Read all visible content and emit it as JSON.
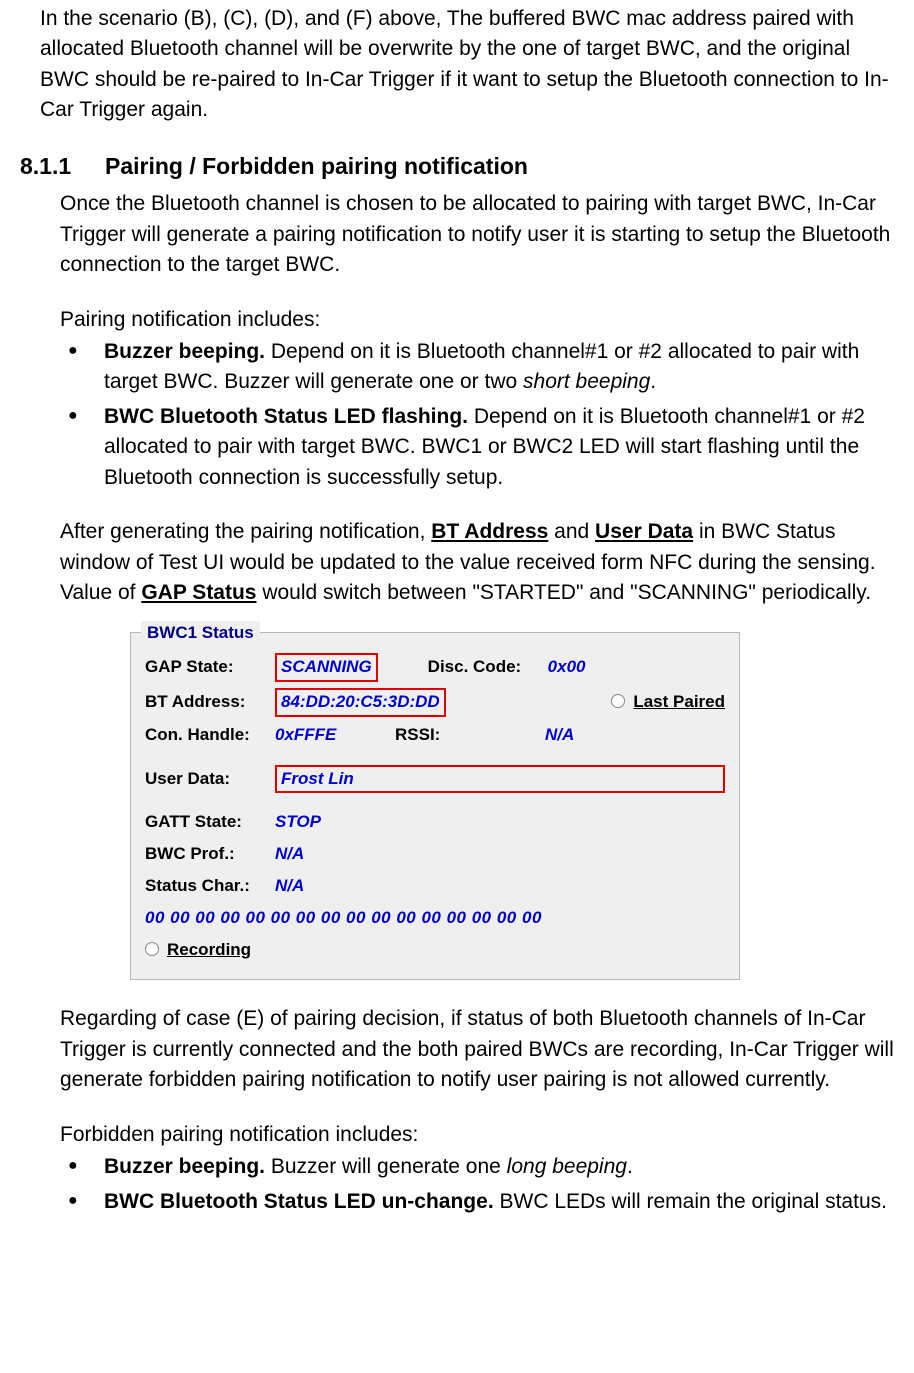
{
  "intro": "In the scenario (B), (C), (D), and (F) above, The buffered BWC mac address paired with allocated Bluetooth channel will be overwrite by the one of target BWC, and the original BWC should be re-paired to In-Car Trigger if it want to setup the Bluetooth connection to In-Car Trigger again.",
  "section_num": "8.1.1",
  "section_title": "Pairing / Forbidden pairing notification",
  "p1": "Once the Bluetooth channel is chosen to be allocated to pairing with target BWC, In-Car Trigger will generate a pairing notification to notify user it is starting to setup the Bluetooth connection to the target BWC.",
  "pair_notif_label": "Pairing notification includes:",
  "pair_list": {
    "b1_bold": "Buzzer beeping.",
    "b1_rest_a": " Depend on it is Bluetooth channel#1 or #2 allocated to pair with target BWC. Buzzer will generate one or two ",
    "b1_italic": "short beeping",
    "b1_rest_b": ".",
    "b2_bold": "BWC Bluetooth Status LED flashing.",
    "b2_rest": " Depend on it is Bluetooth channel#1 or #2 allocated to pair with target BWC. BWC1 or BWC2 LED will start flashing until the Bluetooth connection is successfully setup."
  },
  "p2_a": "After generating the pairing notification, ",
  "p2_u1": "BT Address",
  "p2_b": " and ",
  "p2_u2": "User Data",
  "p2_c": " in BWC Status window of Test UI would be updated to the value received form NFC during the sensing. Value of ",
  "p2_u3": "GAP Status",
  "p2_d": " would switch between \"STARTED\" and \"SCANNING\" periodically.",
  "panel": {
    "title": "BWC1 Status",
    "gap_state_lbl": "GAP State:",
    "gap_state_val": "SCANNING",
    "disc_code_lbl": "Disc. Code:",
    "disc_code_val": "0x00",
    "bt_addr_lbl": "BT Address:",
    "bt_addr_val": "84:DD:20:C5:3D:DD",
    "last_paired_lbl": "Last Paired",
    "con_handle_lbl": "Con. Handle:",
    "con_handle_val": "0xFFFE",
    "rssi_lbl": "RSSI:",
    "rssi_val": "N/A",
    "user_data_lbl": "User Data:",
    "user_data_val": "Frost Lin",
    "gatt_state_lbl": "GATT State:",
    "gatt_state_val": "STOP",
    "bwc_prof_lbl": "BWC Prof.:",
    "bwc_prof_val": "N/A",
    "status_char_lbl": "Status Char.:",
    "status_char_val": "N/A",
    "hex_line": "00 00 00 00 00 00 00 00 00 00 00 00 00 00 00 00",
    "recording_lbl": "Recording"
  },
  "p3": "Regarding of case (E) of pairing decision, if status of both Bluetooth channels of In-Car Trigger is currently connected and the both paired BWCs are recording, In-Car Trigger will generate forbidden pairing notification to notify user pairing is not allowed currently.",
  "forbid_notif_label": "Forbidden pairing notification includes:",
  "forbid_list": {
    "b1_bold": "Buzzer beeping.",
    "b1_rest_a": " Buzzer will generate one ",
    "b1_italic": "long beeping",
    "b1_rest_b": ".",
    "b2_bold": "BWC Bluetooth Status LED un-change.",
    "b2_rest": " BWC LEDs will remain the original status."
  }
}
